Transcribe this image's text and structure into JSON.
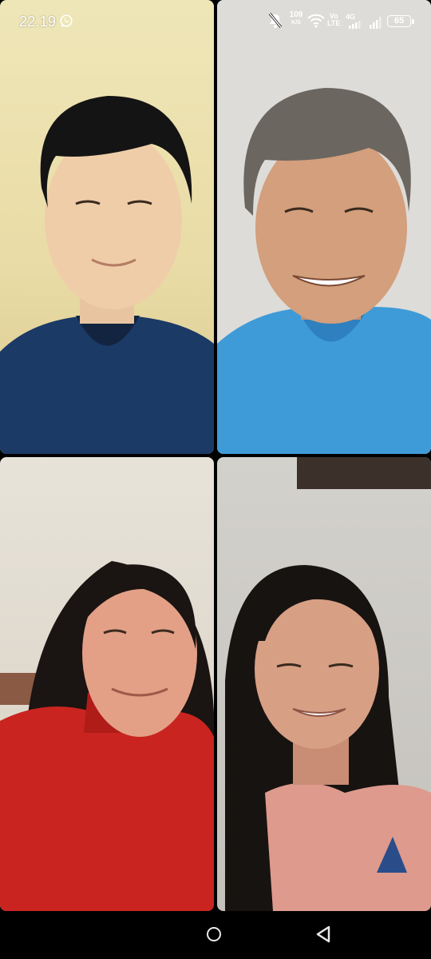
{
  "status_bar": {
    "time": "22.19",
    "net_speed_value": "109",
    "net_speed_unit": "K/S",
    "volte_top": "Vo",
    "volte_bottom": "LTE",
    "network_type": "4G",
    "battery_level": "65"
  },
  "video_call": {
    "participants": [
      {
        "shirt_color": "#1b3a66"
      },
      {
        "shirt_color": "#3f9bd8"
      },
      {
        "shirt_color": "#c9241f"
      },
      {
        "shirt_color": "#dd9a8d"
      }
    ]
  },
  "nav_bar": {
    "buttons": [
      "home-icon",
      "back-icon"
    ]
  }
}
